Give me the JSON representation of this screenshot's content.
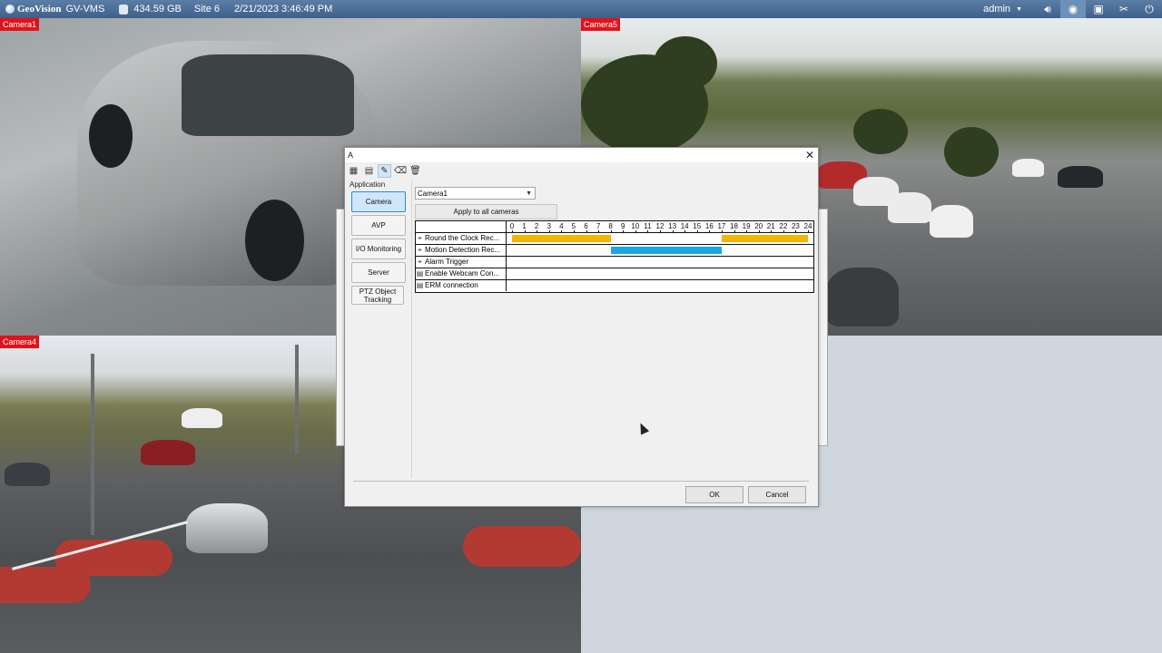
{
  "topbar": {
    "logo": "GeoVision",
    "app": "GV-VMS",
    "storage": "434.59 GB",
    "site": "Site 6",
    "datetime": "2/21/2023 3:46:49 PM",
    "user": "admin"
  },
  "cameras": {
    "tile1": "Camera1",
    "tile5": "Camera5",
    "tile4": "Camera4"
  },
  "dialog": {
    "title": "A",
    "close": "✕",
    "section": "Application",
    "nav": [
      "Camera",
      "AVP",
      "I/O Monitoring",
      "Server"
    ],
    "nav_ptz_line1": "PTZ Object",
    "nav_ptz_line2": "Tracking",
    "selected_nav": "Camera",
    "camera_select": "Camera1",
    "apply_button": "Apply to all cameras",
    "hours": [
      "0",
      "1",
      "2",
      "3",
      "4",
      "5",
      "6",
      "7",
      "8",
      "9",
      "10",
      "11",
      "12",
      "13",
      "14",
      "15",
      "16",
      "17",
      "18",
      "19",
      "20",
      "21",
      "22",
      "23",
      "24"
    ],
    "rows": [
      {
        "label": "Round the Clock Rec...",
        "icon": "camera-icon"
      },
      {
        "label": "Motion Detection Rec...",
        "icon": "camera-icon"
      },
      {
        "label": "Alarm Trigger",
        "icon": "camera-icon"
      },
      {
        "label": "Enable Webcam Con...",
        "icon": "document-icon"
      },
      {
        "label": "ERM connection",
        "icon": "document-icon"
      }
    ],
    "schedules": [
      {
        "row": 0,
        "color": "#f5b400",
        "ranges": [
          [
            0,
            8
          ],
          [
            17,
            24
          ]
        ]
      },
      {
        "row": 1,
        "color": "#1aa7e0",
        "ranges": [
          [
            8,
            17
          ]
        ]
      }
    ],
    "ok": "OK",
    "cancel": "Cancel"
  }
}
